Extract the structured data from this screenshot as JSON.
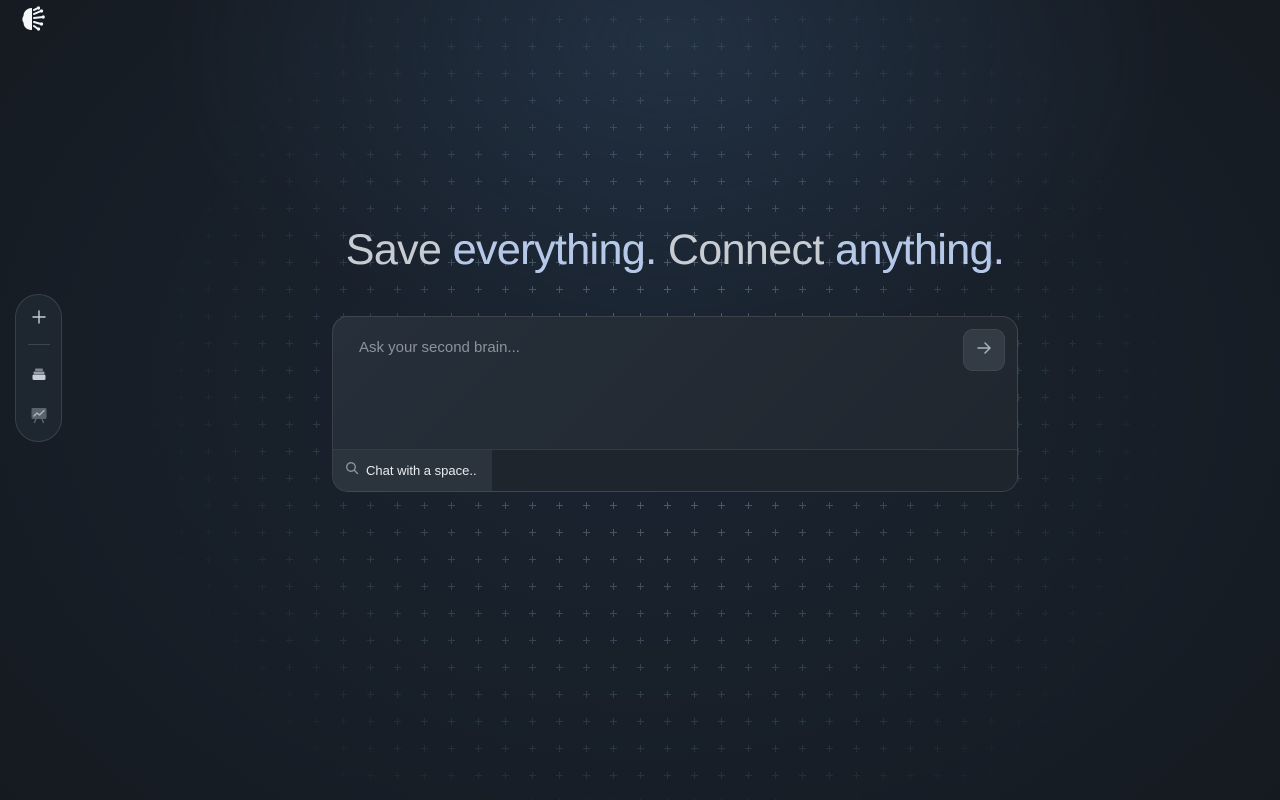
{
  "app": {
    "logo_icon": "brain-icon"
  },
  "sidebar": {
    "items": [
      {
        "id": "add",
        "icon": "plus-icon"
      },
      {
        "id": "memories",
        "icon": "stack-icon"
      },
      {
        "id": "canvas",
        "icon": "chart-board-icon"
      }
    ]
  },
  "hero": {
    "part1": "Save ",
    "part2": "everything.",
    "part3": " Connect ",
    "part4": "anything."
  },
  "chat": {
    "placeholder": "Ask your second brain...",
    "send_icon": "arrow-right-icon",
    "space_picker_label": "Chat with a space..",
    "space_picker_icon": "search-icon"
  },
  "colors": {
    "background": "#171e27",
    "accent": "#b6c8e8",
    "text_muted": "#c7ccd3",
    "panel": "#262f3a"
  }
}
